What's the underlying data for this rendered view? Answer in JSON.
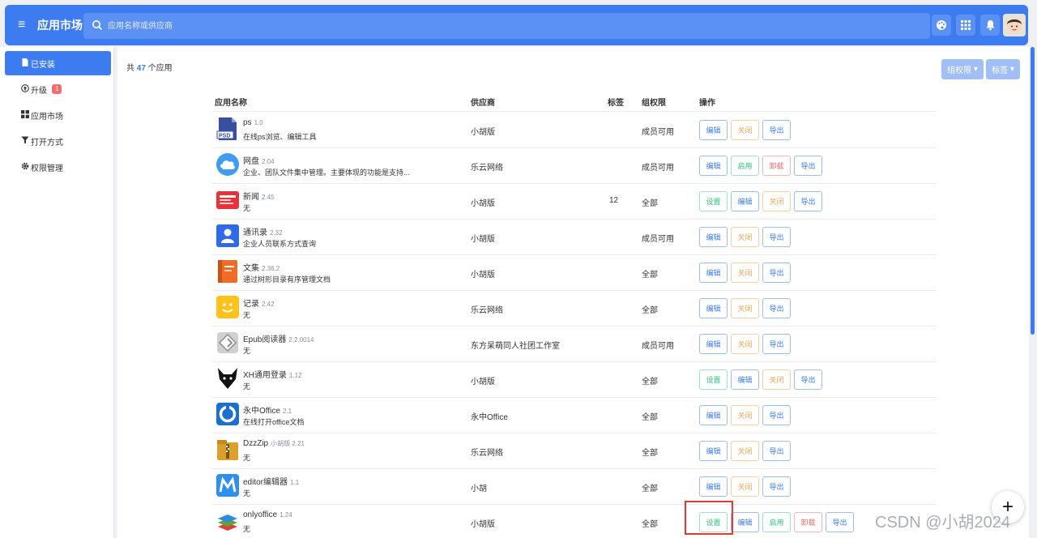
{
  "header": {
    "title": "应用市场",
    "search_placeholder": "应用名称或供应商",
    "icons": [
      "palette-icon",
      "grid-icon",
      "bell-icon",
      "avatar"
    ]
  },
  "sidebar": {
    "items": [
      {
        "label": "已安装",
        "icon": "document-icon",
        "active": true
      },
      {
        "label": "升级",
        "icon": "upgrade-icon",
        "badge": "1"
      },
      {
        "label": "应用市场",
        "icon": "grid-icon"
      },
      {
        "label": "打开方式",
        "icon": "filter-icon"
      },
      {
        "label": "权限管理",
        "icon": "gear-icon"
      }
    ]
  },
  "main": {
    "count_prefix": "共",
    "count": "47",
    "count_suffix": "个应用",
    "filters": [
      "组权限",
      "标签"
    ],
    "columns": {
      "name": "应用名称",
      "vendor": "供应商",
      "tags": "标签",
      "perm": "组权限",
      "ops": "操作"
    },
    "rows": [
      {
        "name": "ps",
        "version": "1.0",
        "desc": "在线ps浏览、编辑工具",
        "vendor": "小胡版",
        "tags": "",
        "perm": "成员可用",
        "icon": "psd-icon",
        "ops": [
          [
            "编辑",
            "edit"
          ],
          [
            "关闭",
            "close"
          ],
          [
            "导出",
            "export"
          ]
        ]
      },
      {
        "name": "网盘",
        "version": "2.04",
        "desc": "企业、团队文件集中管理。主要体现的功能是支持...",
        "vendor": "乐云网络",
        "tags": "",
        "perm": "成员可用",
        "icon": "cloud-icon",
        "ops": [
          [
            "编辑",
            "edit"
          ],
          [
            "启用",
            "enable"
          ],
          [
            "卸载",
            "uninstall"
          ],
          [
            "导出",
            "export"
          ]
        ]
      },
      {
        "name": "新闻",
        "version": "2.45",
        "desc": "无",
        "vendor": "小胡版",
        "tags": "12",
        "perm": "全部",
        "icon": "news-icon",
        "ops": [
          [
            "设置",
            "setting"
          ],
          [
            "编辑",
            "edit"
          ],
          [
            "关闭",
            "close"
          ],
          [
            "导出",
            "export"
          ]
        ]
      },
      {
        "name": "通讯录",
        "version": "2.32",
        "desc": "企业人员联系方式查询",
        "vendor": "小胡版",
        "tags": "",
        "perm": "成员可用",
        "icon": "contacts-icon",
        "ops": [
          [
            "编辑",
            "edit"
          ],
          [
            "关闭",
            "close"
          ],
          [
            "导出",
            "export"
          ]
        ]
      },
      {
        "name": "文集",
        "version": "2.36.2",
        "desc": "通过树形目录有序管理文档",
        "vendor": "小胡版",
        "tags": "",
        "perm": "全部",
        "icon": "book-icon",
        "ops": [
          [
            "编辑",
            "edit"
          ],
          [
            "关闭",
            "close"
          ],
          [
            "导出",
            "export"
          ]
        ]
      },
      {
        "name": "记录",
        "version": "2.42",
        "desc": "无",
        "vendor": "乐云网络",
        "tags": "",
        "perm": "全部",
        "icon": "note-icon",
        "ops": [
          [
            "编辑",
            "edit"
          ],
          [
            "关闭",
            "close"
          ],
          [
            "导出",
            "export"
          ]
        ]
      },
      {
        "name": "Epub阅读器",
        "version": "2.2.0014",
        "desc": "无",
        "vendor": "东方呆萌同人社团工作室",
        "tags": "",
        "perm": "成员可用",
        "icon": "epub-icon",
        "ops": [
          [
            "编辑",
            "edit"
          ],
          [
            "关闭",
            "close"
          ],
          [
            "导出",
            "export"
          ]
        ]
      },
      {
        "name": "XH通用登录",
        "version": "1.12",
        "desc": "无",
        "vendor": "小胡版",
        "tags": "",
        "perm": "全部",
        "icon": "fox-icon",
        "ops": [
          [
            "设置",
            "setting"
          ],
          [
            "编辑",
            "edit"
          ],
          [
            "关闭",
            "close"
          ],
          [
            "导出",
            "export"
          ]
        ]
      },
      {
        "name": "永中Office",
        "version": "2.1",
        "desc": "在线打开office文档",
        "vendor": "永中Office",
        "tags": "",
        "perm": "全部",
        "icon": "office-icon",
        "ops": [
          [
            "编辑",
            "edit"
          ],
          [
            "关闭",
            "close"
          ],
          [
            "导出",
            "export"
          ]
        ]
      },
      {
        "name": "DzzZip",
        "version": "小胡版 2.21",
        "desc": "无",
        "vendor": "乐云网络",
        "tags": "",
        "perm": "全部",
        "icon": "zip-icon",
        "ops": [
          [
            "编辑",
            "edit"
          ],
          [
            "关闭",
            "close"
          ],
          [
            "导出",
            "export"
          ]
        ]
      },
      {
        "name": "editor编辑器",
        "version": "1.1",
        "desc": "无",
        "vendor": "小胡",
        "tags": "",
        "perm": "全部",
        "icon": "editor-icon",
        "ops": [
          [
            "编辑",
            "edit"
          ],
          [
            "关闭",
            "close"
          ],
          [
            "导出",
            "export"
          ]
        ]
      },
      {
        "name": "onlyoffice",
        "version": "1.24",
        "desc": "无",
        "vendor": "小胡版",
        "tags": "",
        "perm": "全部",
        "icon": "layers-icon",
        "ops": [
          [
            "设置",
            "setting"
          ],
          [
            "编辑",
            "edit"
          ],
          [
            "启用",
            "enable"
          ],
          [
            "卸载",
            "uninstall"
          ],
          [
            "导出",
            "export"
          ]
        ]
      }
    ]
  },
  "watermark": "CSDN @小胡2024",
  "fab_label": "+"
}
